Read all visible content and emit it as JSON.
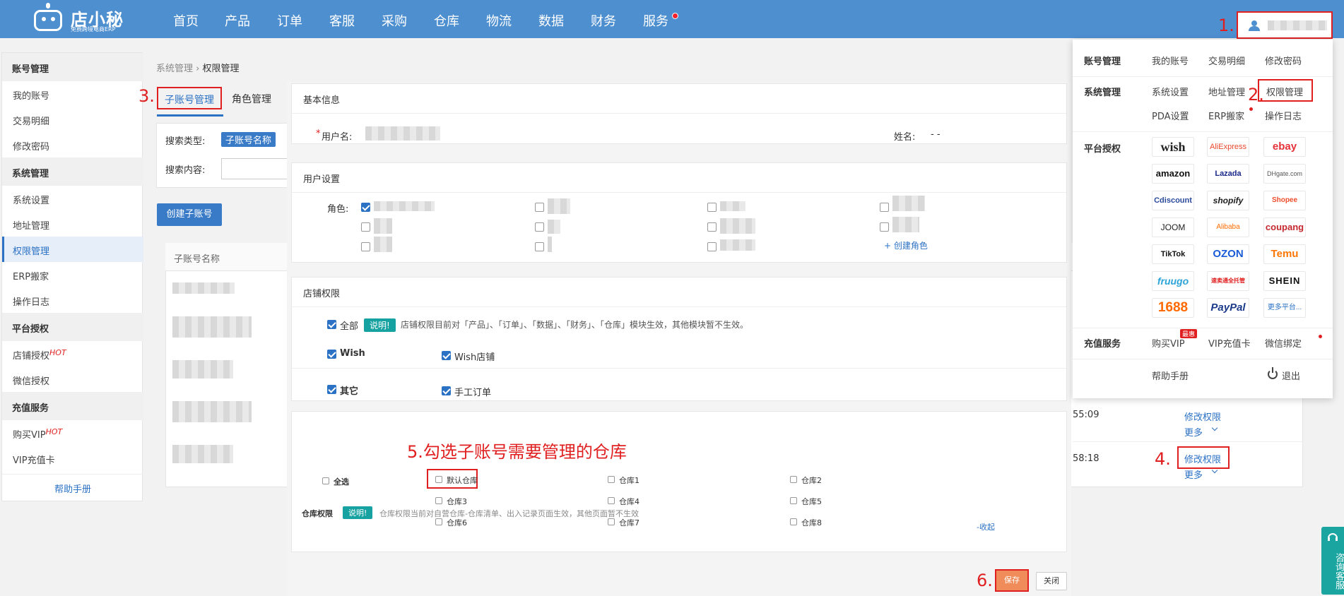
{
  "logo": {
    "name": "店小秘",
    "sub": "免费跨境电商ERP"
  },
  "nav": [
    "首页",
    "产品",
    "订单",
    "客服",
    "采购",
    "仓库",
    "物流",
    "数据",
    "财务",
    "服务"
  ],
  "annotations": {
    "a1": "1.",
    "a2": "2.",
    "a3": "3.",
    "a4": "4.",
    "a5": "5.勾选子账号需要管理的仓库",
    "a6": "6."
  },
  "sidebar": {
    "groups": [
      {
        "title": "账号管理",
        "items": [
          "我的账号",
          "交易明细",
          "修改密码"
        ]
      },
      {
        "title": "系统管理",
        "items": [
          "系统设置",
          "地址管理",
          "权限管理",
          "ERP搬家",
          "操作日志"
        ]
      },
      {
        "title": "平台授权",
        "items": [
          "店铺授权",
          "微信授权"
        ]
      },
      {
        "title": "充值服务",
        "items": [
          "购买VIP",
          "VIP充值卡"
        ]
      }
    ],
    "hot": "HOT",
    "help": "帮助手册"
  },
  "breadcrumb": {
    "parent": "系统管理",
    "sep": "›",
    "current": "权限管理"
  },
  "tabs": [
    "子账号管理",
    "角色管理"
  ],
  "search": {
    "type_label": "搜索类型:",
    "type_value": "子账号名称",
    "content_label": "搜索内容:"
  },
  "create_button": "创建子账号",
  "table": {
    "header_name": "子账号名称",
    "rows": [
      {
        "time": "55:09",
        "edit": "修改权限",
        "more": "更多"
      },
      {
        "time": "58:18",
        "edit": "修改权限",
        "more": "更多"
      }
    ]
  },
  "modal": {
    "basic_title": "基本信息",
    "username_label": "用户名:",
    "required_mark": "*",
    "realname_label": "姓名:",
    "realname_value": "- -",
    "user_settings_title": "用户设置",
    "role_label": "角色:",
    "create_role": "+ 创建角色",
    "shop_title": "店铺权限",
    "all_label": "全部",
    "note_label": "说明!",
    "shop_note": "店铺权限目前对「产品」、「订单」、「数据」、「财务」、「仓库」模块生效，其他模块暂不生效。",
    "wish_label": "Wish",
    "wish_shop": "Wish店铺",
    "other_label": "其它",
    "manual_order": "手工订单",
    "wh_title": "仓库权限",
    "wh_note": "仓库权限当前对自营仓库-仓库清单、出入记录页面生效，其他页面暂不生效",
    "select_all": "全选",
    "warehouses": [
      "默认仓库",
      "仓库1",
      "仓库2",
      "仓库3",
      "仓库4",
      "仓库5",
      "仓库6",
      "仓库7",
      "仓库8"
    ],
    "collapse": "-收起",
    "save": "保存",
    "close": "关闭"
  },
  "dropdown": {
    "account": {
      "title": "账号管理",
      "items": [
        "我的账号",
        "交易明细",
        "修改密码"
      ]
    },
    "system": {
      "title": "系统管理",
      "items": [
        "系统设置",
        "地址管理",
        "权限管理",
        "PDA设置",
        "ERP搬家",
        "操作日志"
      ]
    },
    "platform": {
      "title": "平台授权",
      "platforms": [
        "wish",
        "AliExpress",
        "ebay",
        "amazon",
        "Lazada",
        "DHgate.com",
        "Cdiscount",
        "shopify",
        "Shopee",
        "JOOM",
        "Alibaba",
        "coupang",
        "TikTok",
        "OZON",
        "Temu",
        "fruugo",
        "速卖通全托管",
        "SHEIN",
        "1688",
        "PayPal",
        "更多平台..."
      ]
    },
    "recharge": {
      "title": "充值服务",
      "items": [
        "购买VIP",
        "VIP充值卡",
        "微信绑定"
      ],
      "badge": "最惠"
    },
    "help": "帮助手册",
    "logout": "退出"
  },
  "customer_service": "咨询客服",
  "colors": {
    "topbar": "#4e8fd0",
    "accent": "#2b71c4",
    "annotation": "#e02020",
    "note": "#17a2a2",
    "save": "#f08c5a"
  }
}
